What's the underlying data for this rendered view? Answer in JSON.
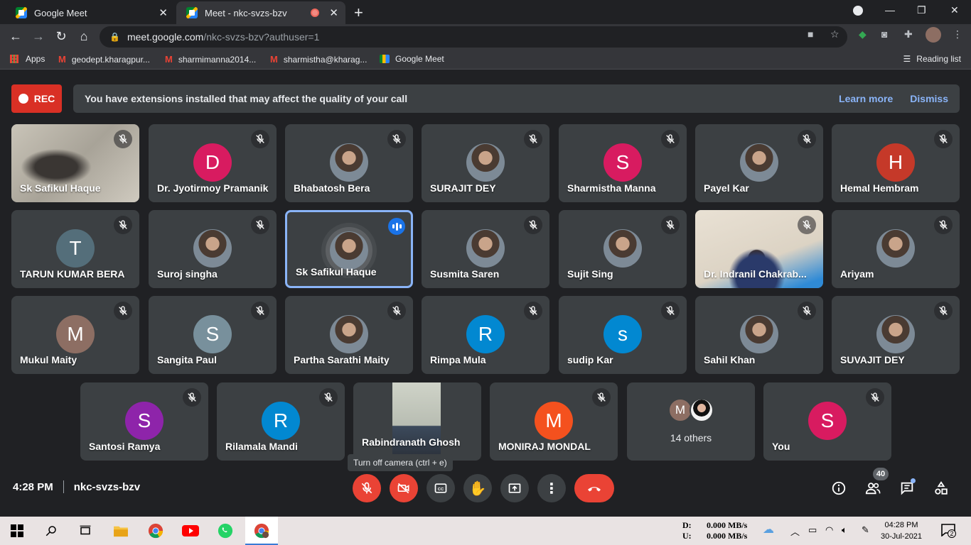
{
  "browser": {
    "tabs": [
      {
        "title": "Google Meet",
        "active": false
      },
      {
        "title": "Meet - nkc-svzs-bzv",
        "active": true
      }
    ],
    "url_host": "meet.google.com",
    "url_path": "/nkc-svzs-bzv?authuser=1",
    "bookmarks": [
      {
        "label": "Apps",
        "icon": "apps-grid-icon"
      },
      {
        "label": "geodept.kharagpur...",
        "icon": "gmail-icon"
      },
      {
        "label": "sharmimanna2014...",
        "icon": "gmail-icon"
      },
      {
        "label": "sharmistha@kharag...",
        "icon": "gmail-icon"
      },
      {
        "label": "Google Meet",
        "icon": "meet-icon"
      }
    ],
    "reading_list": "Reading list"
  },
  "meeting": {
    "rec_label": "REC",
    "banner_message": "You have extensions installed that may affect the quality of your call",
    "learn_more": "Learn more",
    "dismiss": "Dismiss",
    "time": "4:28 PM",
    "code": "nkc-svzs-bzv",
    "tooltip": "Turn off camera (ctrl + e)",
    "participant_count": "40",
    "others_label": "14 others",
    "others_avatar_letter": "M"
  },
  "participants": [
    {
      "name": "Sk Safikul Haque",
      "type": "video",
      "muted": true
    },
    {
      "name": "Dr. Jyotirmoy Pramanik",
      "type": "letter",
      "letter": "D",
      "color": "#d81b60",
      "muted": true
    },
    {
      "name": "Bhabatosh Bera",
      "type": "photo",
      "muted": true
    },
    {
      "name": "SURAJIT DEY",
      "type": "photo",
      "muted": true
    },
    {
      "name": "Sharmistha Manna",
      "type": "letter",
      "letter": "S",
      "color": "#d81b60",
      "muted": true
    },
    {
      "name": "Payel Kar",
      "type": "photo",
      "muted": true
    },
    {
      "name": "Hemal Hembram",
      "type": "letter",
      "letter": "H",
      "color": "#c53929",
      "muted": true
    },
    {
      "name": "TARUN KUMAR BERA",
      "type": "letter",
      "letter": "T",
      "color": "#546e7a",
      "muted": true
    },
    {
      "name": "Suroj singha",
      "type": "photo",
      "muted": true
    },
    {
      "name": "Sk Safikul Haque",
      "type": "photo",
      "muted": false,
      "speaking": true
    },
    {
      "name": "Susmita Saren",
      "type": "photo",
      "muted": true
    },
    {
      "name": "Sujit Sing",
      "type": "photo",
      "muted": true
    },
    {
      "name": "Dr. Indranil Chakrab...",
      "type": "video2",
      "muted": true
    },
    {
      "name": "Ariyam",
      "type": "photo",
      "muted": true
    },
    {
      "name": "Mukul Maity",
      "type": "letter",
      "letter": "M",
      "color": "#8d6e63",
      "muted": true
    },
    {
      "name": "Sangita Paul",
      "type": "letter",
      "letter": "S",
      "color": "#78909c",
      "muted": true
    },
    {
      "name": "Partha Sarathi Maity",
      "type": "photo",
      "muted": true
    },
    {
      "name": "Rimpa Mula",
      "type": "letter",
      "letter": "R",
      "color": "#0288d1",
      "muted": true
    },
    {
      "name": "sudip Kar",
      "type": "letter",
      "letter": "s",
      "color": "#0288d1",
      "muted": true
    },
    {
      "name": "Sahil Khan",
      "type": "photo",
      "muted": true
    },
    {
      "name": "SUVAJIT DEY",
      "type": "photo",
      "muted": true
    },
    {
      "name": "Santosi Ramya",
      "type": "letter",
      "letter": "S",
      "color": "#8e24aa",
      "muted": true
    },
    {
      "name": "Rilamala Mandi",
      "type": "letter",
      "letter": "R",
      "color": "#0288d1",
      "muted": true
    },
    {
      "name": "Rabindranath Ghosh",
      "type": "video3",
      "muted": false
    },
    {
      "name": "MONIRAJ MONDAL",
      "type": "letter",
      "letter": "M",
      "color": "#f4511e",
      "muted": true
    },
    {
      "name": "You",
      "type": "letter",
      "letter": "S",
      "color": "#d81b60",
      "muted": true
    }
  ],
  "taskbar": {
    "download_label": "D:",
    "download_value": "0.000 MB/s",
    "upload_label": "U:",
    "upload_value": "0.000 MB/s",
    "time": "04:28 PM",
    "date": "30-Jul-2021",
    "notification_count": "2"
  }
}
